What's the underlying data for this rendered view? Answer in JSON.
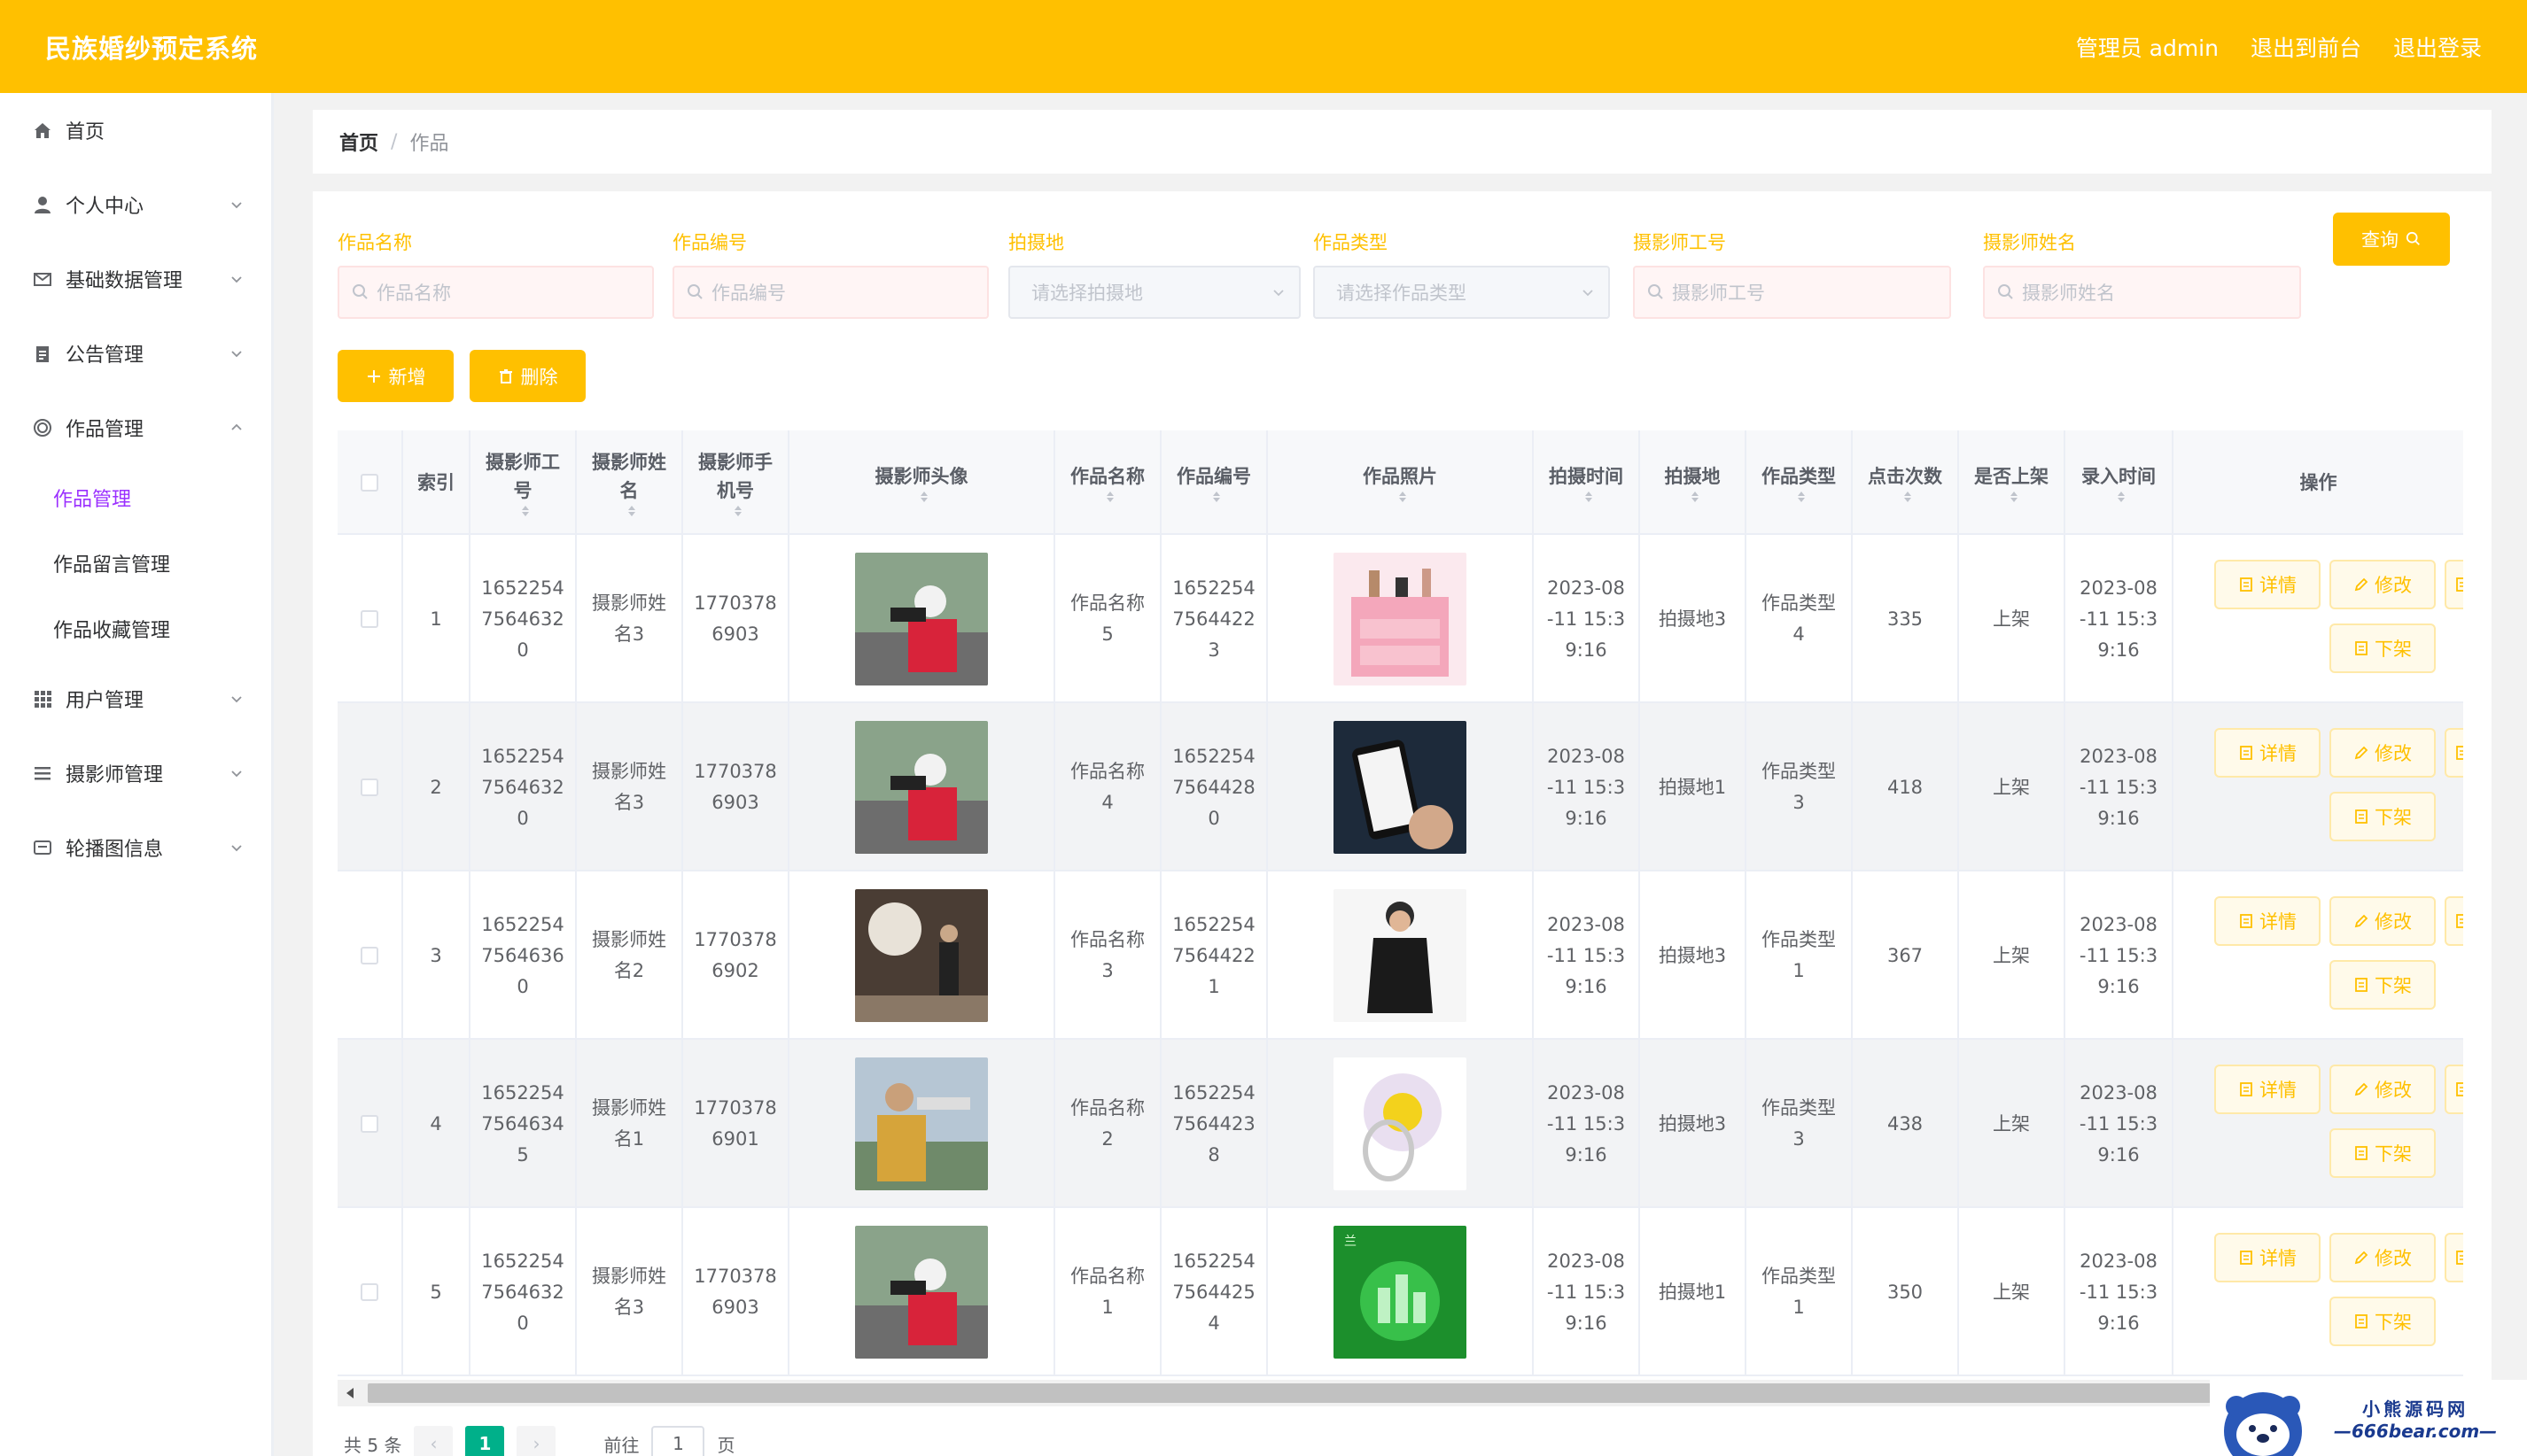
{
  "header": {
    "brand": "民族婚纱预定系统",
    "user_label": "管理员 admin",
    "front_link": "退出到前台",
    "logout_link": "退出登录"
  },
  "sidebar": {
    "items": [
      {
        "label": "首页",
        "icon": "home-icon"
      },
      {
        "label": "个人中心",
        "icon": "user-icon"
      },
      {
        "label": "基础数据管理",
        "icon": "mail-icon"
      },
      {
        "label": "公告管理",
        "icon": "clipboard-icon"
      },
      {
        "label": "作品管理",
        "icon": "circle-icon"
      },
      {
        "label": "用户管理",
        "icon": "grid-icon"
      },
      {
        "label": "摄影师管理",
        "icon": "list-icon"
      },
      {
        "label": "轮播图信息",
        "icon": "image-icon"
      }
    ],
    "subitems": [
      "作品管理",
      "作品留言管理",
      "作品收藏管理"
    ]
  },
  "breadcrumb": {
    "home": "首页",
    "separator": "/",
    "current": "作品"
  },
  "filters": {
    "name_label": "作品名称",
    "name_placeholder": "作品名称",
    "code_label": "作品编号",
    "code_placeholder": "作品编号",
    "place_label": "拍摄地",
    "place_placeholder": "请选择拍摄地",
    "type_label": "作品类型",
    "type_placeholder": "请选择作品类型",
    "pid_label": "摄影师工号",
    "pid_placeholder": "摄影师工号",
    "pname_label": "摄影师姓名",
    "pname_placeholder": "摄影师姓名",
    "search_btn": "查询"
  },
  "actions": {
    "add": "新增",
    "delete": "删除"
  },
  "table": {
    "headers": {
      "index": "索引",
      "pid": "摄影师工\n号",
      "pname": "摄影师姓\n名",
      "phone": "摄影师手\n机号",
      "avatar": "摄影师头像",
      "wname": "作品名称",
      "wcode": "作品编号",
      "photo": "作品照片",
      "time": "拍摄时间",
      "place": "拍摄地",
      "type": "作品类型",
      "clicks": "点击次数",
      "onshelf": "是否上架",
      "created": "录入时间",
      "ops": "操作"
    },
    "rows": [
      {
        "index": "1",
        "pid": "1652254\n7564632\n0",
        "pname": "摄影师姓\n名3",
        "phone": "1770378\n6903",
        "wname": "作品名称\n5",
        "wcode": "1652254\n7564422\n3",
        "time": "2023-08\n-11 15:3\n9:16",
        "place": "拍摄地3",
        "type": "作品类型\n4",
        "clicks": "335",
        "onshelf": "上架",
        "created": "2023-08\n-11 15:3\n9:16"
      },
      {
        "index": "2",
        "pid": "1652254\n7564632\n0",
        "pname": "摄影师姓\n名3",
        "phone": "1770378\n6903",
        "wname": "作品名称\n4",
        "wcode": "1652254\n7564428\n0",
        "time": "2023-08\n-11 15:3\n9:16",
        "place": "拍摄地1",
        "type": "作品类型\n3",
        "clicks": "418",
        "onshelf": "上架",
        "created": "2023-08\n-11 15:3\n9:16"
      },
      {
        "index": "3",
        "pid": "1652254\n7564636\n0",
        "pname": "摄影师姓\n名2",
        "phone": "1770378\n6902",
        "wname": "作品名称\n3",
        "wcode": "1652254\n7564422\n1",
        "time": "2023-08\n-11 15:3\n9:16",
        "place": "拍摄地3",
        "type": "作品类型\n1",
        "clicks": "367",
        "onshelf": "上架",
        "created": "2023-08\n-11 15:3\n9:16"
      },
      {
        "index": "4",
        "pid": "1652254\n7564634\n5",
        "pname": "摄影师姓\n名1",
        "phone": "1770378\n6901",
        "wname": "作品名称\n2",
        "wcode": "1652254\n7564423\n8",
        "time": "2023-08\n-11 15:3\n9:16",
        "place": "拍摄地3",
        "type": "作品类型\n3",
        "clicks": "438",
        "onshelf": "上架",
        "created": "2023-08\n-11 15:3\n9:16"
      },
      {
        "index": "5",
        "pid": "1652254\n7564632\n0",
        "pname": "摄影师姓\n名3",
        "phone": "1770378\n6903",
        "wname": "作品名称\n1",
        "wcode": "1652254\n7564425\n4",
        "time": "2023-08\n-11 15:3\n9:16",
        "place": "拍摄地1",
        "type": "作品类型\n1",
        "clicks": "350",
        "onshelf": "上架",
        "created": "2023-08\n-11 15:3\n9:16"
      }
    ],
    "op_labels": {
      "detail": "详情",
      "edit": "修改",
      "off": "下架"
    }
  },
  "pager": {
    "total": "共 5 条",
    "prev": "‹",
    "current": "1",
    "next": "›",
    "goto": "前往",
    "goto_value": "1",
    "page_unit": "页"
  },
  "watermark": {
    "line1": "小熊源码网",
    "line2": "—666bear.com—"
  },
  "colors": {
    "accent": "#ffc000",
    "active_menu": "#9b30ff",
    "pager_active": "#00b08a"
  }
}
